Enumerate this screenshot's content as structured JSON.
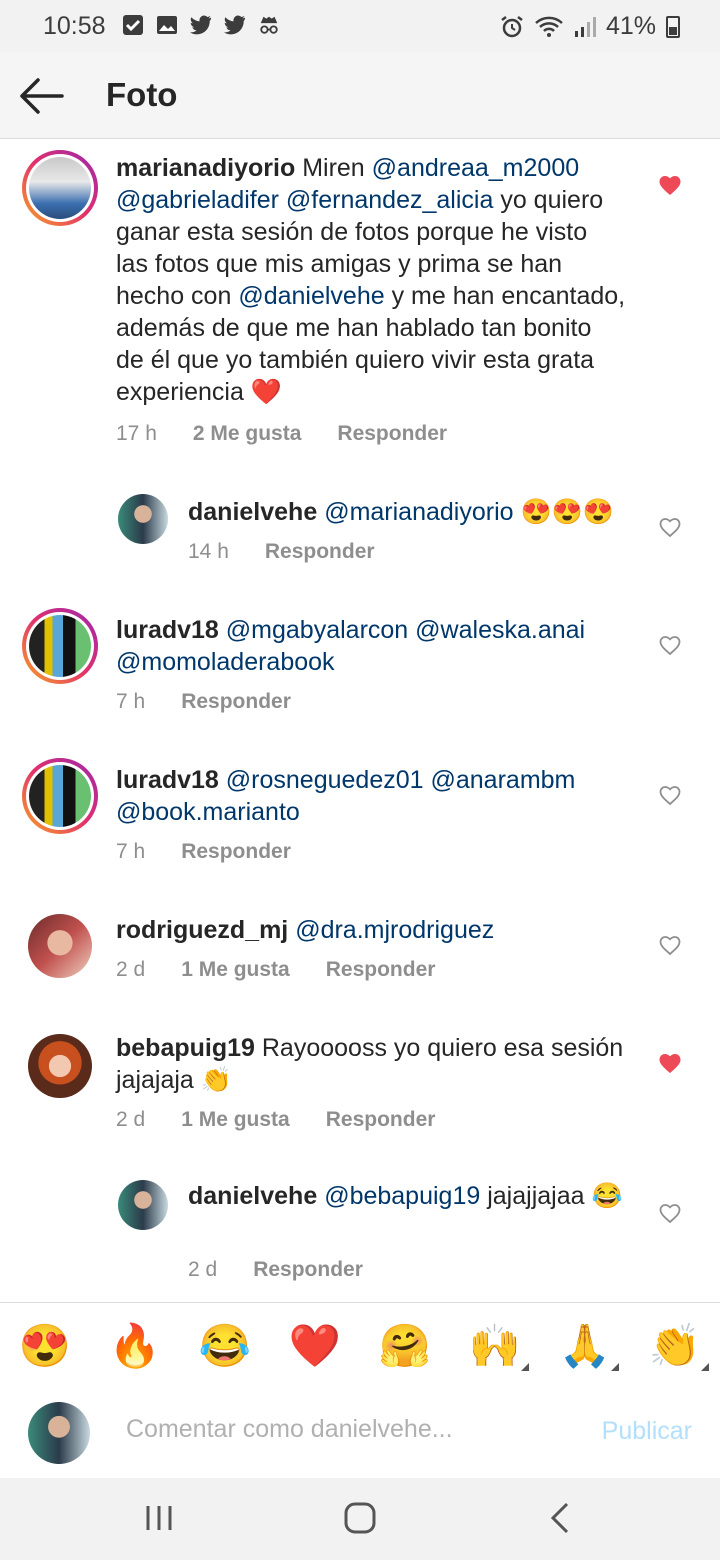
{
  "status_bar": {
    "time": "10:58",
    "battery": "41%"
  },
  "header": {
    "title": "Foto"
  },
  "comments": [
    {
      "username": "marianadiyorio",
      "text_pre": "Miren",
      "mentions": [
        "@andreaa_m2000",
        "@gabrieladifer",
        "@fernandez_alicia"
      ],
      "text_mid": "yo quiero ganar esta sesión de fotos porque he visto las fotos que mis amigas y prima se han hecho con",
      "mention2": "@danielvehe",
      "text_post": "y me han encantado, además de que me han hablado tan bonito de él que yo también quiero vivir esta grata experiencia",
      "emoji": "❤️",
      "time": "17 h",
      "likes": "2 Me gusta",
      "reply": "Responder",
      "liked": true
    },
    {
      "username": "danielvehe",
      "mention": "@marianadiyorio",
      "emoji": "😍😍😍",
      "time": "14 h",
      "reply": "Responder",
      "liked": false
    },
    {
      "username": "luradv18",
      "mentions": [
        "@mgabyalarcon",
        "@waleska.anai",
        "@momoladerabook"
      ],
      "time": "7 h",
      "reply": "Responder",
      "liked": false
    },
    {
      "username": "luradv18",
      "mentions": [
        "@rosneguedez01",
        "@anarambm",
        "@book.marianto"
      ],
      "time": "7 h",
      "reply": "Responder",
      "liked": false
    },
    {
      "username": "rodriguezd_mj",
      "mention": "@dra.mjrodriguez",
      "time": "2 d",
      "likes": "1 Me gusta",
      "reply": "Responder",
      "liked": false
    },
    {
      "username": "bebapuig19",
      "text": "Rayooooss yo quiero esa sesión jajajaja",
      "emoji": "👏",
      "time": "2 d",
      "likes": "1 Me gusta",
      "reply": "Responder",
      "liked": true
    },
    {
      "username": "danielvehe",
      "mention": "@bebapuig19",
      "text": "jajajjajaa",
      "emoji": "😂",
      "time": "2 d",
      "reply": "Responder",
      "liked": false
    }
  ],
  "emoji_bar": [
    "😍",
    "🔥",
    "😂",
    "❤️",
    "🤗",
    "🙌",
    "🙏",
    "👏"
  ],
  "comment_input": {
    "placeholder": "Comentar como danielvehe...",
    "publish": "Publicar"
  },
  "colors": {
    "mention": "#00376b",
    "liked_heart": "#ed4956",
    "publish_disabled": "#b2dffc"
  }
}
